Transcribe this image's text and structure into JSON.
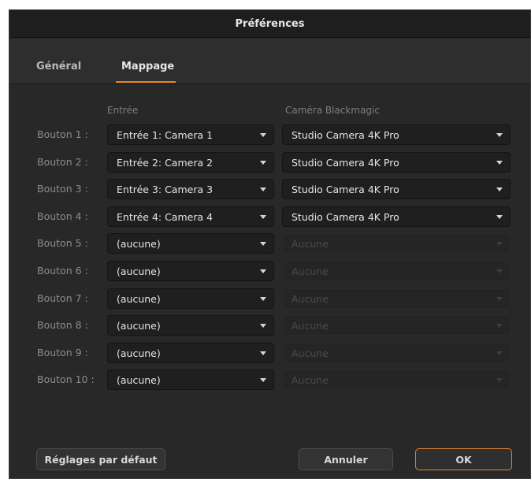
{
  "window": {
    "title": "Préférences"
  },
  "tabs": [
    {
      "label": "Général",
      "active": false
    },
    {
      "label": "Mappage",
      "active": true
    }
  ],
  "columns": {
    "input": "Entrée",
    "camera": "Caméra Blackmagic"
  },
  "rows": [
    {
      "label": "Bouton 1 :",
      "input": "Entrée 1: Camera 1",
      "camera": "Studio Camera 4K Pro",
      "camera_enabled": true
    },
    {
      "label": "Bouton 2 :",
      "input": "Entrée 2: Camera 2",
      "camera": "Studio Camera 4K Pro",
      "camera_enabled": true
    },
    {
      "label": "Bouton 3 :",
      "input": "Entrée 3: Camera 3",
      "camera": "Studio Camera 4K Pro",
      "camera_enabled": true
    },
    {
      "label": "Bouton 4 :",
      "input": "Entrée 4: Camera 4",
      "camera": "Studio Camera 4K Pro",
      "camera_enabled": true
    },
    {
      "label": "Bouton 5 :",
      "input": "(aucune)",
      "camera": "Aucune",
      "camera_enabled": false
    },
    {
      "label": "Bouton 6 :",
      "input": "(aucune)",
      "camera": "Aucune",
      "camera_enabled": false
    },
    {
      "label": "Bouton 7 :",
      "input": "(aucune)",
      "camera": "Aucune",
      "camera_enabled": false
    },
    {
      "label": "Bouton 8 :",
      "input": "(aucune)",
      "camera": "Aucune",
      "camera_enabled": false
    },
    {
      "label": "Bouton 9 :",
      "input": "(aucune)",
      "camera": "Aucune",
      "camera_enabled": false
    },
    {
      "label": "Bouton 10 :",
      "input": "(aucune)",
      "camera": "Aucune",
      "camera_enabled": false
    }
  ],
  "buttons": {
    "defaults": "Réglages par défaut",
    "cancel": "Annuler",
    "ok": "OK"
  },
  "colors": {
    "accent": "#e8861f",
    "background": "#282828"
  },
  "icons": {
    "dropdown": "chevron-down-icon"
  }
}
